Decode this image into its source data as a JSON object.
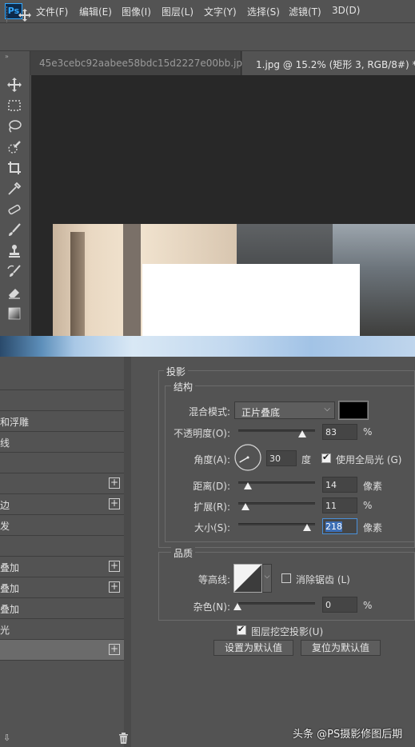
{
  "menubar": {
    "logo": "Ps",
    "items": [
      "文件(F)",
      "编辑(E)",
      "图像(I)",
      "图层(L)",
      "文字(Y)",
      "选择(S)",
      "滤镜(T)",
      "3D(D)"
    ]
  },
  "tabs": [
    {
      "label": "45e3cebc92aabee58bdc15d2227e00bb.jpg",
      "active": false
    },
    {
      "label": "1.jpg @ 15.2% (矩形 3, RGB/8#) *",
      "active": true
    }
  ],
  "toolbox": {
    "collapse": "»",
    "tools": [
      "move-tool",
      "marquee-tool",
      "lasso-tool",
      "quick-selection-tool",
      "crop-tool",
      "eyedropper-tool",
      "healing-brush-tool",
      "brush-tool",
      "clone-stamp-tool",
      "history-brush-tool",
      "eraser-tool",
      "gradient-tool"
    ]
  },
  "styles_panel": {
    "rows": [
      {
        "label": "",
        "plus": false,
        "selected": false
      },
      {
        "label": "",
        "plus": false,
        "selected": false
      },
      {
        "label": "和浮雕",
        "plus": false,
        "selected": false
      },
      {
        "label": "线",
        "plus": false,
        "selected": false
      },
      {
        "label": "",
        "plus": false,
        "selected": false
      },
      {
        "label": "",
        "plus": true,
        "selected": false
      },
      {
        "label": "边",
        "plus": true,
        "selected": false
      },
      {
        "label": "发",
        "plus": false,
        "selected": false
      },
      {
        "label": "",
        "plus": false,
        "selected": false
      },
      {
        "label": "叠加",
        "plus": true,
        "selected": false
      },
      {
        "label": "叠加",
        "plus": true,
        "selected": false
      },
      {
        "label": "叠加",
        "plus": false,
        "selected": false
      },
      {
        "label": "光",
        "plus": false,
        "selected": false
      },
      {
        "label": "",
        "plus": true,
        "selected": true
      }
    ],
    "bottom_icons": {
      "fx": "⇩",
      "trash": "🗑"
    }
  },
  "dialog": {
    "section_title": "投影",
    "structure_title": "结构",
    "blend_mode_label": "混合模式:",
    "blend_mode_value": "正片叠底",
    "shadow_color": "#000000",
    "opacity_label": "不透明度(O):",
    "opacity_value": "83",
    "opacity_unit": "%",
    "opacity_level": 0.83,
    "angle_label": "角度(A):",
    "angle_value": "30",
    "angle_unit": "度",
    "global_light_label": "使用全局光 (G)",
    "global_light_checked": true,
    "distance_label": "距离(D):",
    "distance_value": "14",
    "distance_unit": "像素",
    "spread_label": "扩展(R):",
    "spread_value": "11",
    "spread_unit": "%",
    "size_label": "大小(S):",
    "size_value": "218",
    "size_unit": "像素",
    "quality_title": "品质",
    "contour_label": "等高线:",
    "antialias_label": "消除锯齿 (L)",
    "antialias_checked": false,
    "noise_label": "杂色(N):",
    "noise_value": "0",
    "noise_unit": "%",
    "knockout_label": "图层挖空投影(U)",
    "knockout_checked": true,
    "make_default_label": "设置为默认值",
    "reset_default_label": "复位为默认值"
  },
  "watermark": "头条 @PS摄影修图后期"
}
